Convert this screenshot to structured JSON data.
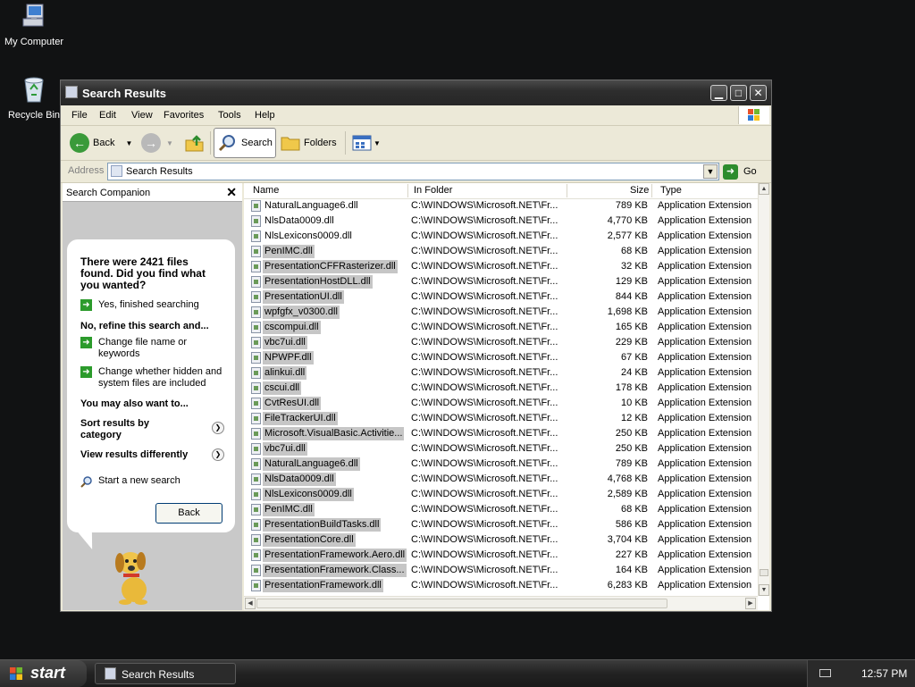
{
  "desktop": {
    "icons": [
      {
        "label": "My Computer",
        "icon": "my-computer-icon"
      },
      {
        "label": "Recycle Bin",
        "icon": "recycle-bin-icon"
      }
    ]
  },
  "window": {
    "title": "Search Results",
    "menu": [
      "File",
      "Edit",
      "View",
      "Favorites",
      "Tools",
      "Help"
    ],
    "toolbar": {
      "back": "Back",
      "search": "Search",
      "folders": "Folders"
    },
    "address": {
      "label": "Address",
      "value": "Search Results",
      "go": "Go"
    }
  },
  "companion": {
    "header": "Search Companion",
    "close": "✕",
    "found_text": "There were 2421 files found. Did you find what you wanted?",
    "yes": "Yes, finished searching",
    "refine_heading": "No, refine this search and...",
    "change_name": "Change file name or keywords",
    "change_hidden": "Change whether hidden and system files are included",
    "also_heading": "You may also want to...",
    "sort": "Sort results by category",
    "view_diff": "View results differently",
    "new_search": "Start a new search",
    "back_button": "Back"
  },
  "results": {
    "columns": [
      "Name",
      "In Folder",
      "Size",
      "Type"
    ],
    "rows": [
      {
        "name": "NaturalLanguage6.dll",
        "folder": "C:\\WINDOWS\\Microsoft.NET\\Fr...",
        "size": "789 KB",
        "type": "Application Extension",
        "selected": false
      },
      {
        "name": "NlsData0009.dll",
        "folder": "C:\\WINDOWS\\Microsoft.NET\\Fr...",
        "size": "4,770 KB",
        "type": "Application Extension",
        "selected": false
      },
      {
        "name": "NlsLexicons0009.dll",
        "folder": "C:\\WINDOWS\\Microsoft.NET\\Fr...",
        "size": "2,577 KB",
        "type": "Application Extension",
        "selected": false
      },
      {
        "name": "PenIMC.dll",
        "folder": "C:\\WINDOWS\\Microsoft.NET\\Fr...",
        "size": "68 KB",
        "type": "Application Extension",
        "selected": true
      },
      {
        "name": "PresentationCFFRasterizer.dll",
        "folder": "C:\\WINDOWS\\Microsoft.NET\\Fr...",
        "size": "32 KB",
        "type": "Application Extension",
        "selected": true
      },
      {
        "name": "PresentationHostDLL.dll",
        "folder": "C:\\WINDOWS\\Microsoft.NET\\Fr...",
        "size": "129 KB",
        "type": "Application Extension",
        "selected": true
      },
      {
        "name": "PresentationUI.dll",
        "folder": "C:\\WINDOWS\\Microsoft.NET\\Fr...",
        "size": "844 KB",
        "type": "Application Extension",
        "selected": true
      },
      {
        "name": "wpfgfx_v0300.dll",
        "folder": "C:\\WINDOWS\\Microsoft.NET\\Fr...",
        "size": "1,698 KB",
        "type": "Application Extension",
        "selected": true
      },
      {
        "name": "cscompui.dll",
        "folder": "C:\\WINDOWS\\Microsoft.NET\\Fr...",
        "size": "165 KB",
        "type": "Application Extension",
        "selected": true
      },
      {
        "name": "vbc7ui.dll",
        "folder": "C:\\WINDOWS\\Microsoft.NET\\Fr...",
        "size": "229 KB",
        "type": "Application Extension",
        "selected": true
      },
      {
        "name": "NPWPF.dll",
        "folder": "C:\\WINDOWS\\Microsoft.NET\\Fr...",
        "size": "67 KB",
        "type": "Application Extension",
        "selected": true
      },
      {
        "name": "alinkui.dll",
        "folder": "C:\\WINDOWS\\Microsoft.NET\\Fr...",
        "size": "24 KB",
        "type": "Application Extension",
        "selected": true
      },
      {
        "name": "cscui.dll",
        "folder": "C:\\WINDOWS\\Microsoft.NET\\Fr...",
        "size": "178 KB",
        "type": "Application Extension",
        "selected": true
      },
      {
        "name": "CvtResUI.dll",
        "folder": "C:\\WINDOWS\\Microsoft.NET\\Fr...",
        "size": "10 KB",
        "type": "Application Extension",
        "selected": true
      },
      {
        "name": "FileTrackerUI.dll",
        "folder": "C:\\WINDOWS\\Microsoft.NET\\Fr...",
        "size": "12 KB",
        "type": "Application Extension",
        "selected": true
      },
      {
        "name": "Microsoft.VisualBasic.Activitie...",
        "folder": "C:\\WINDOWS\\Microsoft.NET\\Fr...",
        "size": "250 KB",
        "type": "Application Extension",
        "selected": true
      },
      {
        "name": "vbc7ui.dll",
        "folder": "C:\\WINDOWS\\Microsoft.NET\\Fr...",
        "size": "250 KB",
        "type": "Application Extension",
        "selected": true
      },
      {
        "name": "NaturalLanguage6.dll",
        "folder": "C:\\WINDOWS\\Microsoft.NET\\Fr...",
        "size": "789 KB",
        "type": "Application Extension",
        "selected": true
      },
      {
        "name": "NlsData0009.dll",
        "folder": "C:\\WINDOWS\\Microsoft.NET\\Fr...",
        "size": "4,768 KB",
        "type": "Application Extension",
        "selected": true
      },
      {
        "name": "NlsLexicons0009.dll",
        "folder": "C:\\WINDOWS\\Microsoft.NET\\Fr...",
        "size": "2,589 KB",
        "type": "Application Extension",
        "selected": true
      },
      {
        "name": "PenIMC.dll",
        "folder": "C:\\WINDOWS\\Microsoft.NET\\Fr...",
        "size": "68 KB",
        "type": "Application Extension",
        "selected": true
      },
      {
        "name": "PresentationBuildTasks.dll",
        "folder": "C:\\WINDOWS\\Microsoft.NET\\Fr...",
        "size": "586 KB",
        "type": "Application Extension",
        "selected": true
      },
      {
        "name": "PresentationCore.dll",
        "folder": "C:\\WINDOWS\\Microsoft.NET\\Fr...",
        "size": "3,704 KB",
        "type": "Application Extension",
        "selected": true
      },
      {
        "name": "PresentationFramework.Aero.dll",
        "folder": "C:\\WINDOWS\\Microsoft.NET\\Fr...",
        "size": "227 KB",
        "type": "Application Extension",
        "selected": true
      },
      {
        "name": "PresentationFramework.Class...",
        "folder": "C:\\WINDOWS\\Microsoft.NET\\Fr...",
        "size": "164 KB",
        "type": "Application Extension",
        "selected": true
      },
      {
        "name": "PresentationFramework.dll",
        "folder": "C:\\WINDOWS\\Microsoft.NET\\Fr...",
        "size": "6,283 KB",
        "type": "Application Extension",
        "selected": true
      }
    ]
  },
  "taskbar": {
    "start": "start",
    "task": "Search Results",
    "clock": "12:57 PM"
  },
  "colors": {
    "desktop": "#111213",
    "selection": "#c6c6c6",
    "companion_bg": "#c9c9c9",
    "arrow_green": "#2c9b2c"
  }
}
